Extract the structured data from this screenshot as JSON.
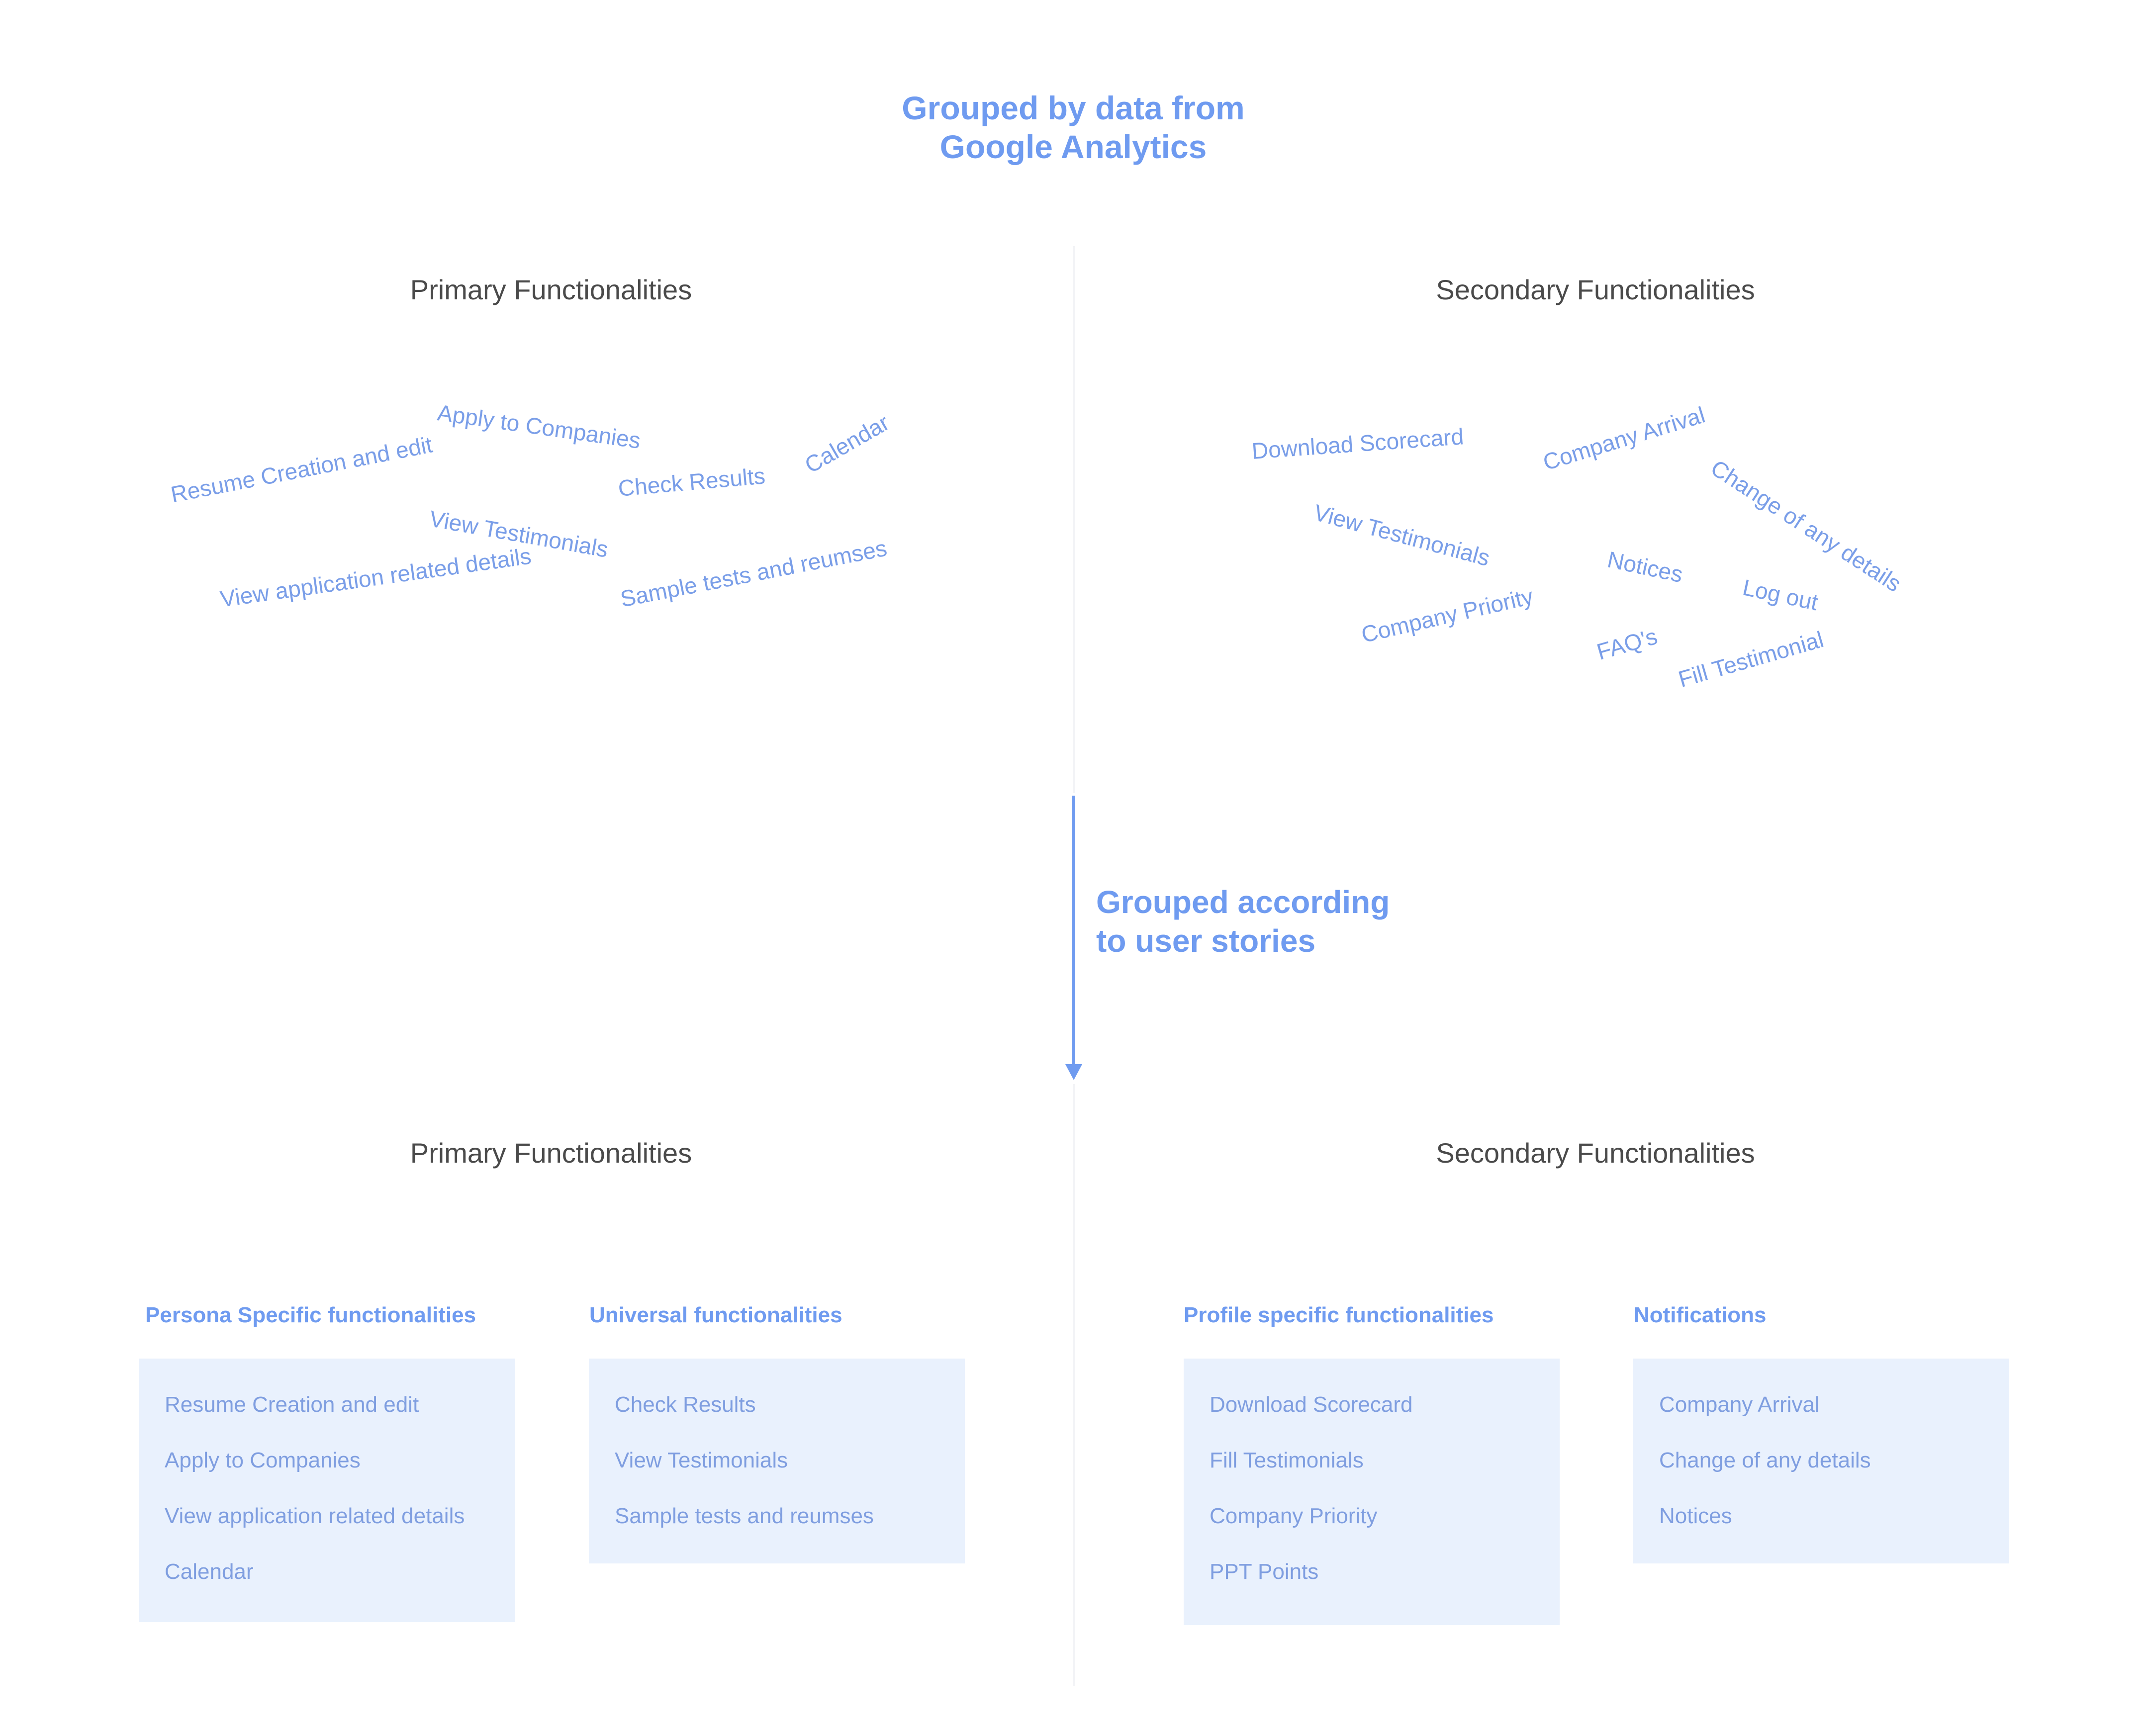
{
  "title": [
    "Grouped  by data from",
    "Google Analytics"
  ],
  "top": {
    "primary_heading": "Primary Functionalities",
    "secondary_heading": "Secondary Functionalities",
    "primary_tags": [
      "Apply to Companies",
      "Resume Creation and edit",
      "Check Results",
      "Calendar",
      "View Testimonials",
      "View application related details",
      "Sample tests and reumses"
    ],
    "secondary_tags": [
      "Download Scorecard",
      "Company Arrival",
      "Change of any details",
      "View Testimonials",
      "Notices",
      "Log out",
      "Company Priority",
      "FAQ's",
      "Fill Testimonial"
    ]
  },
  "transition_label": [
    "Grouped according",
    "to user stories"
  ],
  "bottom": {
    "primary_heading": "Primary Functionalities",
    "secondary_heading": "Secondary Functionalities",
    "groups": [
      {
        "title": "Persona Specific functionalities",
        "items": [
          "Resume Creation and edit",
          "Apply to Companies",
          "View application related details",
          "Calendar"
        ]
      },
      {
        "title": "Universal functionalities",
        "items": [
          "Check Results",
          "View Testimonials",
          "Sample tests and reumses"
        ]
      },
      {
        "title": "Profile specific functionalities",
        "items": [
          "Download Scorecard",
          "Fill Testimonials",
          "Company Priority",
          "PPT Points"
        ]
      },
      {
        "title": "Notifications",
        "items": [
          "Company Arrival",
          "Change of any details",
          "Notices"
        ]
      }
    ]
  },
  "colors": {
    "accent": "#6f9bf0",
    "card_bg": "#e9f1fd",
    "heading": "#4a4a4a",
    "divider": "#f2f3f6"
  }
}
